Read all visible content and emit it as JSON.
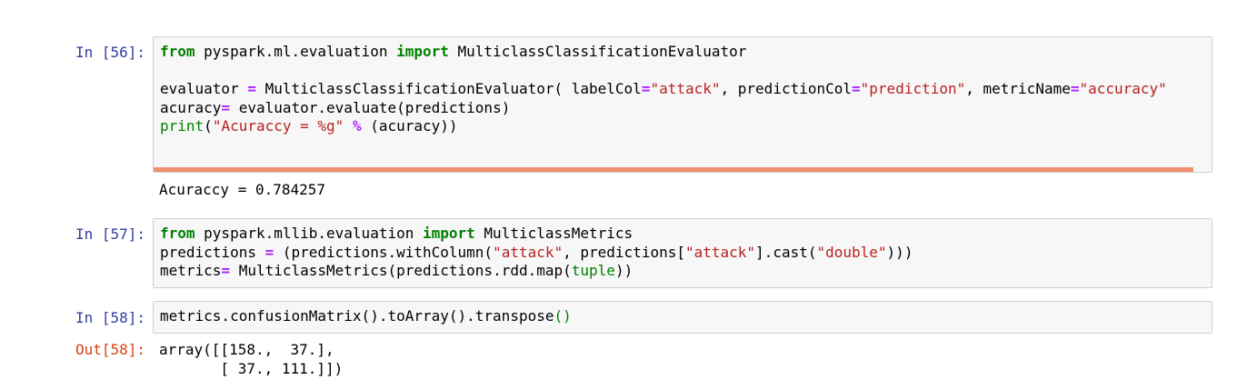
{
  "cells": [
    {
      "prompt": "In [56]:",
      "lines": [
        [
          {
            "t": "from",
            "c": "kw"
          },
          {
            "t": " pyspark.ml.evaluation "
          },
          {
            "t": "import",
            "c": "kw"
          },
          {
            "t": " MulticlassClassificationEvaluator"
          }
        ],
        [],
        [
          {
            "t": "evaluator "
          },
          {
            "t": "=",
            "c": "op"
          },
          {
            "t": " MulticlassClassificationEvaluator( labelCol"
          },
          {
            "t": "=",
            "c": "op"
          },
          {
            "t": "\"attack\"",
            "c": "str"
          },
          {
            "t": ", predictionCol"
          },
          {
            "t": "=",
            "c": "op"
          },
          {
            "t": "\"prediction\"",
            "c": "str"
          },
          {
            "t": ", metricName"
          },
          {
            "t": "=",
            "c": "op"
          },
          {
            "t": "\"accuracy\"",
            "c": "str"
          }
        ],
        [
          {
            "t": "acuracy"
          },
          {
            "t": "=",
            "c": "op"
          },
          {
            "t": " evaluator.evaluate(predictions)"
          }
        ],
        [
          {
            "t": "print",
            "c": "bi"
          },
          {
            "t": "("
          },
          {
            "t": "\"Acuraccy = %g\"",
            "c": "str"
          },
          {
            "t": " "
          },
          {
            "t": "%",
            "c": "op"
          },
          {
            "t": " (acuracy))"
          }
        ]
      ],
      "output": "Acuraccy = 0.784257"
    },
    {
      "prompt": "In [57]:",
      "lines": [
        [
          {
            "t": "from",
            "c": "kw"
          },
          {
            "t": " pyspark.mllib.evaluation "
          },
          {
            "t": "import",
            "c": "kw"
          },
          {
            "t": " MulticlassMetrics"
          }
        ],
        [
          {
            "t": "predictions "
          },
          {
            "t": "=",
            "c": "op"
          },
          {
            "t": " (predictions.withColumn("
          },
          {
            "t": "\"attack\"",
            "c": "str"
          },
          {
            "t": ", predictions["
          },
          {
            "t": "\"attack\"",
            "c": "str"
          },
          {
            "t": "].cast("
          },
          {
            "t": "\"double\"",
            "c": "str"
          },
          {
            "t": ")))"
          }
        ],
        [
          {
            "t": "metrics"
          },
          {
            "t": "=",
            "c": "op"
          },
          {
            "t": " MulticlassMetrics(predictions.rdd.map("
          },
          {
            "t": "tuple",
            "c": "bi"
          },
          {
            "t": "))"
          }
        ]
      ]
    },
    {
      "prompt": "In [58]:",
      "lines": [
        [
          {
            "t": "metrics.confusionMatrix().toArray().transpose"
          },
          {
            "t": "()",
            "c": "bi"
          }
        ]
      ],
      "out_prompt": "Out[58]:",
      "output": "array([[158.,  37.],\n       [ 37., 111.]])"
    }
  ]
}
